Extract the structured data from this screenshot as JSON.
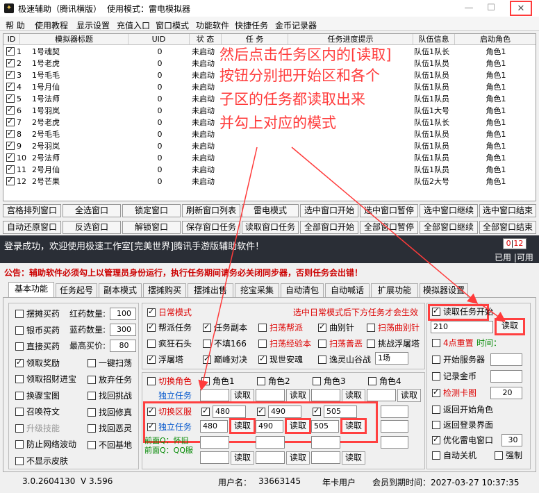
{
  "window": {
    "title": "极速辅助（腾讯横版）",
    "mode": "使用模式：雷电模拟器",
    "icon": "app-icon"
  },
  "menu": [
    "帮 助",
    "使用教程",
    "显示设置",
    "充值入口",
    "窗口模式",
    "功能软件",
    "快捷任务",
    "金币记录器"
  ],
  "grid": {
    "headers": [
      "ID",
      "模拟器标题",
      "UID",
      "状 态",
      "任 务",
      "任务进度提示",
      "队伍信息",
      "启动角色"
    ],
    "rows": [
      {
        "id": "1",
        "title": "1号魂契",
        "uid": "0",
        "status": "未启动",
        "team": "队伍1队长",
        "role": "角色1"
      },
      {
        "id": "2",
        "title": "1号老虎",
        "uid": "0",
        "status": "未启动",
        "team": "队伍1队员",
        "role": "角色1"
      },
      {
        "id": "3",
        "title": "1号毛毛",
        "uid": "0",
        "status": "未启动",
        "team": "队伍1队员",
        "role": "角色1"
      },
      {
        "id": "4",
        "title": "1号月仙",
        "uid": "0",
        "status": "未启动",
        "team": "队伍1队员",
        "role": "角色1"
      },
      {
        "id": "5",
        "title": "1号法师",
        "uid": "0",
        "status": "未启动",
        "team": "队伍1队员",
        "role": "角色1"
      },
      {
        "id": "6",
        "title": "1号羽岚",
        "uid": "0",
        "status": "未启动",
        "team": "队伍1大号",
        "role": "角色1"
      },
      {
        "id": "7",
        "title": "2号老虎",
        "uid": "0",
        "status": "未启动",
        "team": "队伍1队长",
        "role": "角色1"
      },
      {
        "id": "8",
        "title": "2号毛毛",
        "uid": "0",
        "status": "未启动",
        "team": "队伍1队员",
        "role": "角色1"
      },
      {
        "id": "9",
        "title": "2号羽岚",
        "uid": "0",
        "status": "未启动",
        "team": "队伍1队员",
        "role": "角色1"
      },
      {
        "id": "10",
        "title": "2号法师",
        "uid": "0",
        "status": "未启动",
        "team": "队伍1队员",
        "role": "角色1"
      },
      {
        "id": "11",
        "title": "2号月仙",
        "uid": "0",
        "status": "未启动",
        "team": "队伍1队员",
        "role": "角色1"
      },
      {
        "id": "12",
        "title": "2号芒果",
        "uid": "0",
        "status": "未启动",
        "team": "队伍2大号",
        "role": "角色1"
      }
    ]
  },
  "buttons_row1": [
    "宫格排列窗口",
    "全选窗口",
    "锁定窗口",
    "刷新窗口列表",
    "雷电模式",
    "选中窗口开始",
    "选中窗口暂停",
    "选中窗口继续",
    "选中窗口结束"
  ],
  "buttons_row2": [
    "自动还原窗口",
    "反选窗口",
    "解锁窗口",
    "保存窗口任务",
    "读取窗口任务",
    "全部窗口开始",
    "全部窗口暂停",
    "全部窗口继续",
    "全部窗口结束"
  ],
  "banner": {
    "text": "登录成功，欢迎使用极速工作室[完美世界]腾讯手游版辅助软件！",
    "counter_used": "0",
    "counter_sep": "|",
    "counter_total": "12",
    "usable": "已用 |可用"
  },
  "notice": "公告：辅助软件必须勾上以管理员身份运行，执行任务期间请务必关闭同步器，否则任务会出错！",
  "tabs": [
    "基本功能",
    "任务起号",
    "副本模式",
    "摆摊购买",
    "摆摊出售",
    "挖宝采集",
    "自动清包",
    "自动喊话",
    "扩展功能",
    "模拟器设置"
  ],
  "left": {
    "c1": "摆摊买药",
    "c2": "银币买药",
    "c3": "直接买药",
    "c4": "领取奖励",
    "c5": "领取招财进宝",
    "c6": "换骤宝图",
    "c7": "召唤符文",
    "c8": "升级技能",
    "c9": "防止网络波动",
    "c10": "不显示皮肤",
    "r1": "一键扫荡",
    "r2": "放弃任务",
    "r3": "找回挑战",
    "r4": "找回修真",
    "r5": "找回恶灵",
    "r6": "不回基地",
    "red_label": "红药数量:",
    "red_val": "100",
    "blue_label": "蓝药数量:",
    "blue_val": "300",
    "price_label": "最高买价:",
    "price_val": "80"
  },
  "daily": {
    "title": "日常模式",
    "hint": "选中日常模式后下方任务才会生效",
    "items": [
      "帮派任务",
      "任务副本",
      "扫荡帮派",
      "曲别针",
      "扫荡曲别针",
      "疯狂石头",
      "不填166",
      "扫荡经验本",
      "扫荡善恶",
      "挑战浮屠塔",
      "浮屠塔",
      "巅峰对决",
      "现世安魂",
      "逸灵山谷战"
    ],
    "select": "1场"
  },
  "roles": {
    "switch_role": "切换角色",
    "solo_task": "独立任务",
    "role_labels": [
      "角色1",
      "角色2",
      "角色3",
      "角色4"
    ],
    "read": "读取",
    "switch_server": "切换区服",
    "servers": [
      "480",
      "490",
      "505"
    ],
    "solo_vals": [
      "480",
      "490",
      "505"
    ],
    "front_q": "前面Q：怀旧",
    "front_qq": "前面Q：QQ服"
  },
  "right": {
    "read_start": "读取任务开始",
    "start_val": "210",
    "read": "读取",
    "reset_label": "4点重置",
    "time_label": "时间：",
    "start_server": "开始服务器",
    "record_gold": "记录金币",
    "detect_card": "检测卡图",
    "detect_val": "20",
    "return_role": "返回开始角色",
    "return_login": "返回登录界面",
    "optimize": "优化雷电窗口",
    "optimize_val": "30",
    "auto_shutdown": "自动关机",
    "force": "强制"
  },
  "statusbar": {
    "version": "3.0.2604130",
    "v": "V 3.596",
    "user_label": "用户名：",
    "user": "33663145",
    "plan": "年卡用户",
    "expire": "会员到期时间：2027-03-27 10:37:35"
  },
  "annotation": {
    "line1": "然后点击任务区内的[读取]",
    "line2": "按钮分别把开始区和各个",
    "line3": "子区的任务都读取出来",
    "line4": "并勾上对应的模式"
  },
  "colors": {
    "annotation": "#ff3b3b",
    "notice": "#cc0000",
    "banner_bg": "#2a2e36"
  }
}
